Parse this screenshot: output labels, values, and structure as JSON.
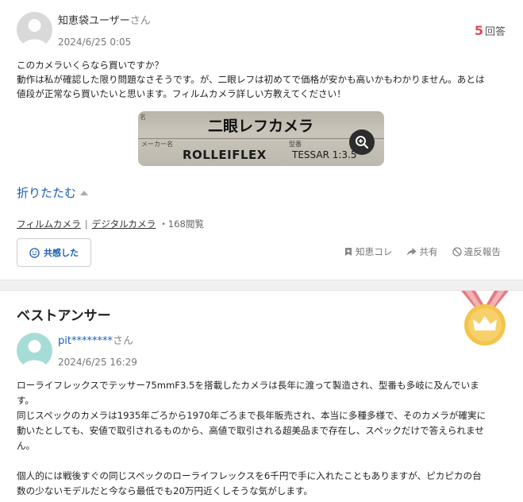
{
  "question": {
    "user_name": "知恵袋ユーザー",
    "user_suffix": "さん",
    "date": "2024/6/25 0:05",
    "answer_count": "5",
    "answer_count_label": "回答",
    "body_lines": [
      "このカメラいくらなら買いですか？",
      "動作は私が確認した限り問題なさそうです。が、二眼レフは初めてで価格が安かも高いかもわかりません。あとは",
      "値段が正常なら買いたいと思います。フィルムカメラ詳しい方教えてください！"
    ],
    "image": {
      "title_text": "二眼レフカメラ",
      "label_name": "名",
      "label_maker": "メーカー名",
      "label_model": "型番",
      "brand": "ROLLEIFLEX",
      "lens": "TESSAR 1:3.5"
    },
    "fold_label": "折りたたむ",
    "tags": [
      "フィルムカメラ",
      "デジタルカメラ"
    ],
    "tag_separator": "|",
    "views": "・168閲覧",
    "empathy_label": "共感した",
    "actions": {
      "chiekore": "知恵コレ",
      "share": "共有",
      "report": "違反報告"
    }
  },
  "best_answer": {
    "section_title": "ベストアンサー",
    "user_name": "pit********",
    "user_suffix": "さん",
    "date": "2024/6/25 16:29",
    "paragraph1": [
      "ローライフレックスでテッサー75mmF3.5を搭載したカメラは長年に渡って製造され、型番も多岐に及んでいま",
      "す。",
      "同じスペックのカメラは1935年ごろから1970年ごろまで長年販売され、本当に多種多様で、そのカメラが確実に",
      "動いたとしても、安値で取引されるものから、高値で取引される超美品まで存在し、スペックだけで答えられませ",
      "ん。"
    ],
    "paragraph2": [
      "個人的には戦後すぐの同じスペックのローライフレックスを6千円で手に入れたこともありますが、ピカピカの台",
      "数の少ないモデルだと今なら最低でも20万円近くしそうな気がします。"
    ]
  },
  "colors": {
    "link_blue": "#1a5fb4",
    "answer_count_red": "#e0475a",
    "medal_gold": "#f2c54a",
    "medal_ribbon": "#e47b82"
  }
}
